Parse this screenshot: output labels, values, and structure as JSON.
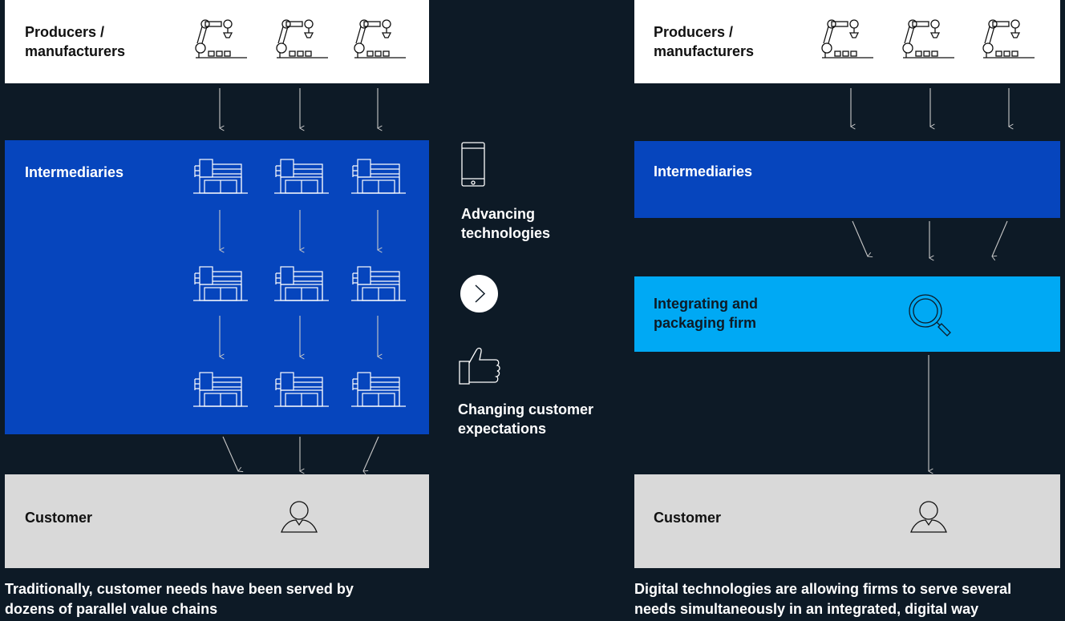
{
  "left": {
    "producers_label": "Producers /\nmanufacturers",
    "intermediaries_label": "Intermediaries",
    "customer_label": "Customer",
    "caption": "Traditionally, customer needs have been served by dozens of parallel value chains"
  },
  "middle": {
    "technologies_label": "Advancing technologies",
    "expectations_label": "Changing customer expectations",
    "icons": [
      "smartphone-icon",
      "chevron-right-icon",
      "thumbs-up-icon"
    ]
  },
  "right": {
    "producers_label": "Producers /\nmanufacturers",
    "intermediaries_label": "Intermediaries",
    "integrator_label": "Integrating and packaging firm",
    "customer_label": "Customer",
    "caption": "Digital technologies are allowing firms to serve several needs simultaneously in an integrated, digital way"
  },
  "colors": {
    "background": "#0d1a26",
    "intermediaries": "#0645bd",
    "integrator": "#00a9f4",
    "customer": "#d9d9d9",
    "producers": "#ffffff"
  }
}
